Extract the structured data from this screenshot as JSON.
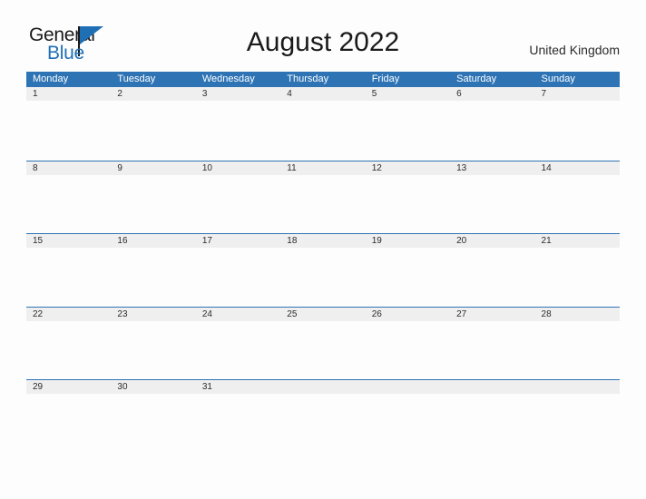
{
  "brand": {
    "name_top": "General",
    "name_bottom": "Blue",
    "flag_icon": "blue-triangle-flag-icon",
    "accent_color": "#1f6fb5"
  },
  "header": {
    "title": "August 2022",
    "locale": "United Kingdom"
  },
  "theme": {
    "header_blue": "#2e74b5",
    "row_gray": "#efefef",
    "page_background": "#fdfdfd",
    "text_color": "#2b2b2b"
  },
  "calendar": {
    "month": "August",
    "year": "2022",
    "first_day_of_week": "Monday",
    "weekdays": [
      "Monday",
      "Tuesday",
      "Wednesday",
      "Thursday",
      "Friday",
      "Saturday",
      "Sunday"
    ],
    "weeks": [
      {
        "days": [
          {
            "num": "1"
          },
          {
            "num": "2"
          },
          {
            "num": "3"
          },
          {
            "num": "4"
          },
          {
            "num": "5"
          },
          {
            "num": "6"
          },
          {
            "num": "7"
          }
        ]
      },
      {
        "days": [
          {
            "num": "8"
          },
          {
            "num": "9"
          },
          {
            "num": "10"
          },
          {
            "num": "11"
          },
          {
            "num": "12"
          },
          {
            "num": "13"
          },
          {
            "num": "14"
          }
        ]
      },
      {
        "days": [
          {
            "num": "15"
          },
          {
            "num": "16"
          },
          {
            "num": "17"
          },
          {
            "num": "18"
          },
          {
            "num": "19"
          },
          {
            "num": "20"
          },
          {
            "num": "21"
          }
        ]
      },
      {
        "days": [
          {
            "num": "22"
          },
          {
            "num": "23"
          },
          {
            "num": "24"
          },
          {
            "num": "25"
          },
          {
            "num": "26"
          },
          {
            "num": "27"
          },
          {
            "num": "28"
          }
        ]
      },
      {
        "days": [
          {
            "num": "29"
          },
          {
            "num": "30"
          },
          {
            "num": "31"
          },
          {
            "num": ""
          },
          {
            "num": ""
          },
          {
            "num": ""
          },
          {
            "num": ""
          }
        ]
      }
    ]
  }
}
